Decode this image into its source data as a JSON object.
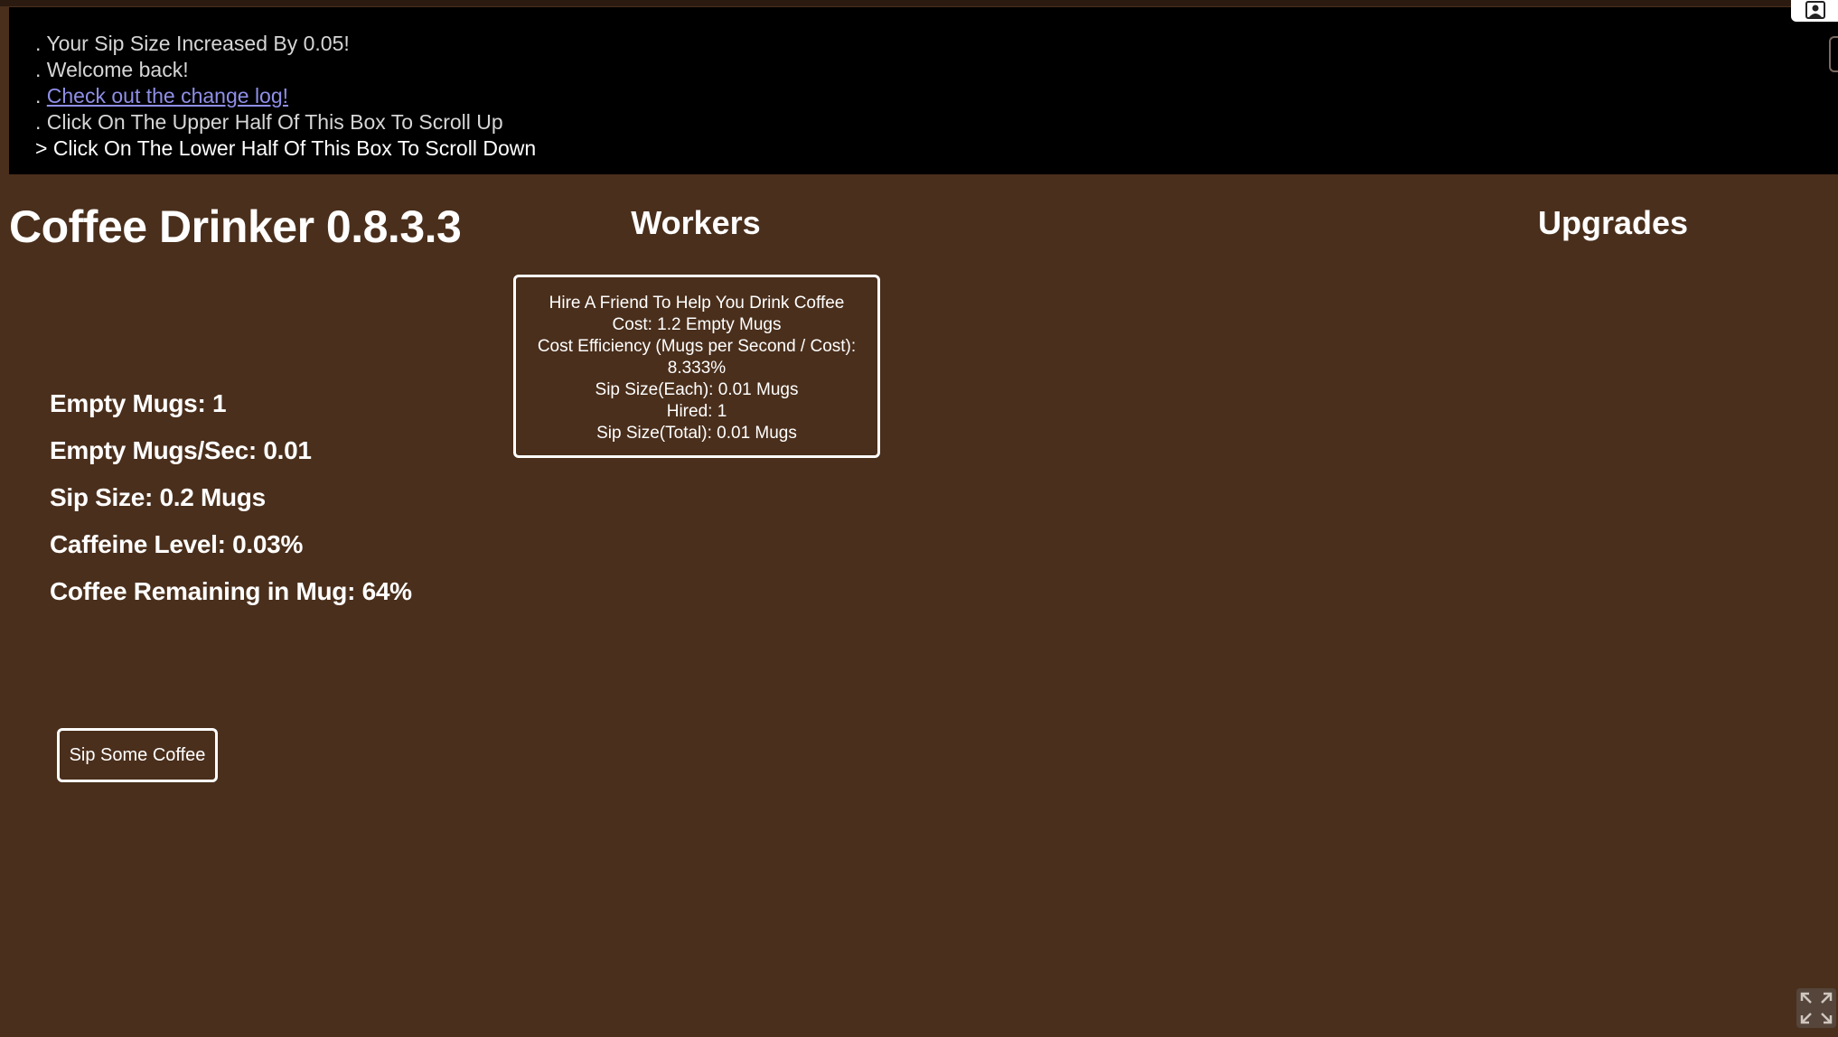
{
  "log": {
    "lines": [
      ". Your Sip Size Increased By 0.05!",
      ". Welcome back!",
      ". Click On The Upper Half Of This Box To Scroll Up",
      "> Click On The Lower Half Of This Box To Scroll Down"
    ],
    "link_prefix": ". ",
    "link_text": "Check out the change log!"
  },
  "game": {
    "title": "Coffee Drinker 0.8.3.3"
  },
  "sections": {
    "workers": "Workers",
    "upgrades": "Upgrades"
  },
  "stats": {
    "empty_mugs": "Empty Mugs: 1",
    "empty_mugs_per_sec": "Empty Mugs/Sec: 0.01",
    "sip_size": "Sip Size: 0.2 Mugs",
    "caffeine_level": "Caffeine Level: 0.03%",
    "coffee_remaining": "Coffee Remaining in Mug: 64%"
  },
  "worker": {
    "name": "Hire A Friend To Help You Drink Coffee",
    "cost": "Cost: 1.2 Empty Mugs",
    "efficiency_label": "Cost Efficiency (Mugs per Second / Cost):",
    "efficiency_value": "8.333%",
    "sip_each": "Sip Size(Each): 0.01 Mugs",
    "hired": "Hired: 1",
    "sip_total": "Sip Size(Total): 0.01 Mugs"
  },
  "actions": {
    "sip_button": "Sip Some Coffee"
  },
  "icons": {
    "corner": "user-icon",
    "fullscreen": "fullscreen-icon"
  },
  "colors": {
    "background": "#4a2f1c",
    "log_background": "#000000",
    "link": "#8f8fe8"
  }
}
